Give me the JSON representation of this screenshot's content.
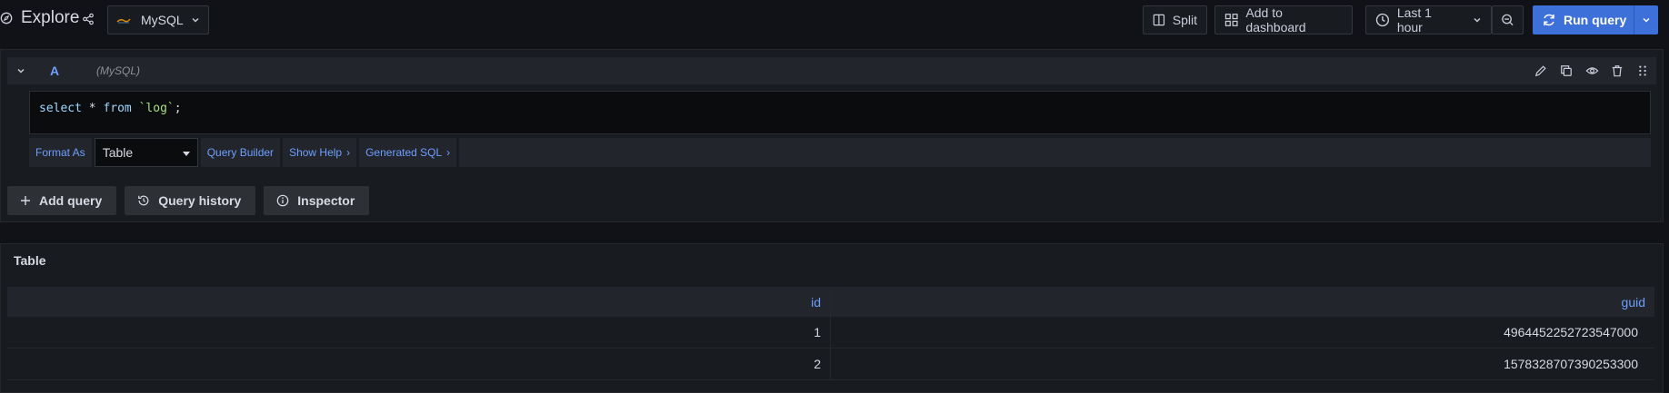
{
  "header": {
    "title": "Explore",
    "datasource": "MySQL",
    "split_label": "Split",
    "add_dashboard_label": "Add to dashboard",
    "time_range": "Last 1 hour",
    "run_label": "Run query"
  },
  "query": {
    "ref_id": "A",
    "datasource_hint": "(MySQL)",
    "sql": {
      "kw1": "select",
      "star": " * ",
      "kw2": "from",
      "table": " `log`",
      "end": ";"
    },
    "format_as_label": "Format As",
    "format_value": "Table",
    "query_builder_label": "Query Builder",
    "show_help_label": "Show Help",
    "generated_sql_label": "Generated SQL"
  },
  "actions": {
    "add_query": "Add query",
    "query_history": "Query history",
    "inspector": "Inspector"
  },
  "results": {
    "panel_title": "Table",
    "columns": [
      "id",
      "guid"
    ],
    "rows": [
      [
        "1",
        "4964452252723547000"
      ],
      [
        "2",
        "1578328707390253300"
      ]
    ]
  },
  "colors": {
    "accent": "#3d71d9",
    "link": "#6e9fff",
    "background": "#111217",
    "panel": "#181b1f"
  }
}
